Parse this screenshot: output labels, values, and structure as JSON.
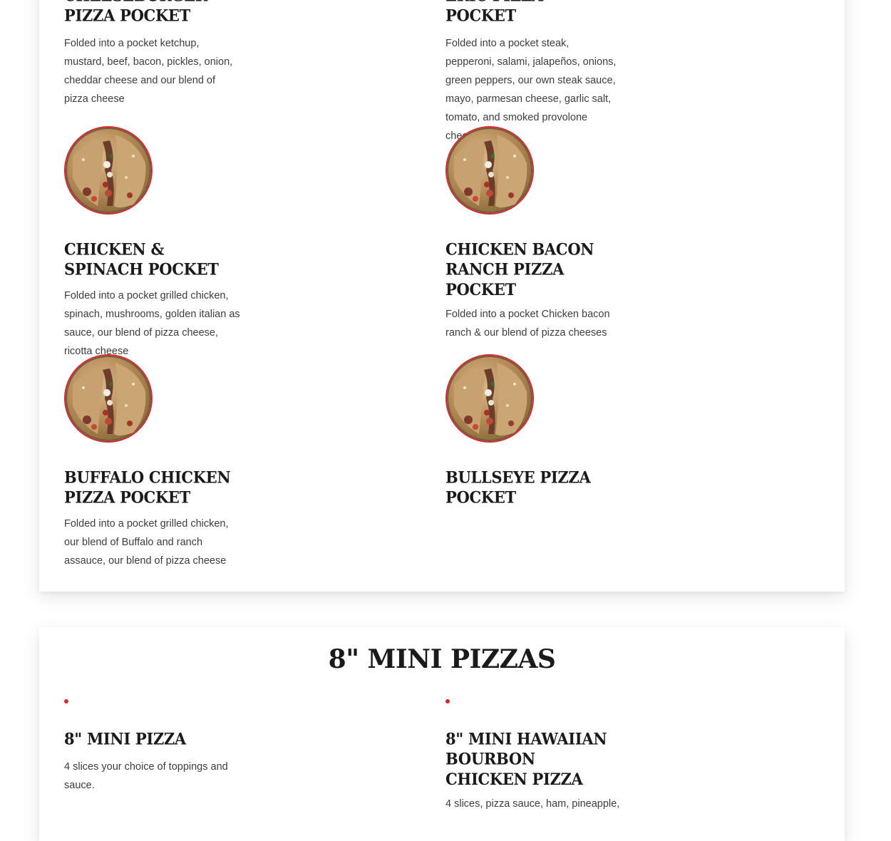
{
  "colors": {
    "accent": "#d42a2a",
    "heading": "#1a1a1a",
    "text": "#3d3d3d"
  },
  "pockets": {
    "cheeseburger": {
      "title": "Cheeseburger Pizza Pocket",
      "desc": "Folded into a pocket ketchup, mustard, beef, bacon, pickles, onion, cheddar cheese and our blend of pizza cheese"
    },
    "eric": {
      "title": "Eric Pizza Pocket",
      "desc": "Folded into a pocket steak, pepperoni, salami, jalapeños, onions, green peppers, our own steak sauce, mayo, parmesan cheese, garlic salt, tomato, and smoked provolone cheese"
    },
    "chicken_spinach": {
      "title": "Chicken & Spinach Pocket",
      "desc": "Folded into a pocket grilled chicken, spinach, mushrooms, golden italian as sauce, our blend of pizza cheese, ricotta cheese"
    },
    "chicken_bacon_ranch": {
      "title": "Chicken Bacon Ranch Pizza Pocket",
      "desc": "Folded into a pocket Chicken bacon ranch & our blend of pizza cheeses"
    },
    "buffalo_chicken": {
      "title": "Buffalo Chicken Pizza Pocket",
      "desc": "Folded into a pocket grilled chicken, our blend of Buffalo and ranch assauce, our blend of pizza cheese"
    },
    "bullseye": {
      "title": "Bullseye Pizza Pocket"
    }
  },
  "mini_section": {
    "title": "8\" Mini Pizzas",
    "items": [
      {
        "title": "8\" Mini Pizza",
        "desc": "4 slices your choice of toppings and sauce."
      },
      {
        "title": "8\" Mini Hawaiian Bourbon Chicken Pizza",
        "desc": "4 slices, pizza sauce, ham, pineapple,"
      }
    ]
  },
  "icons": {
    "pocket_image": "pizza-pocket-photo"
  }
}
